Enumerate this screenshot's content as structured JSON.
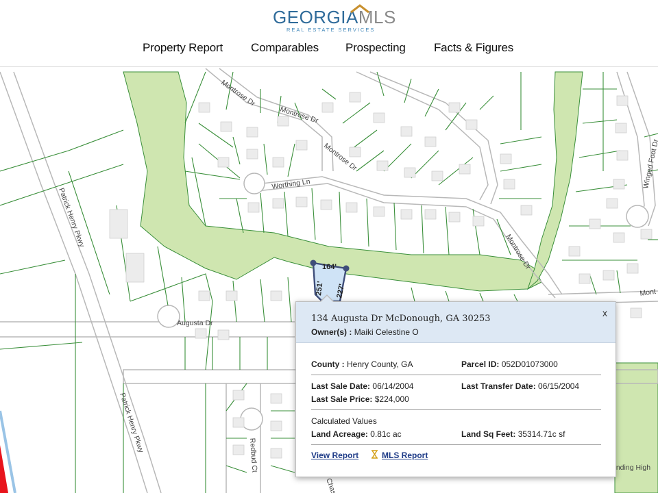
{
  "header": {
    "logo_main": "GEORGIA",
    "logo_mls": "MLS",
    "logo_sub": "REAL ESTATE SERVICES",
    "nav": [
      "Property Report",
      "Comparables",
      "Prospecting",
      "Facts & Figures"
    ]
  },
  "map": {
    "street_labels": {
      "montrose_1": "Montrose Dr",
      "montrose_2": "Montrose Dr",
      "montrose_3": "Montrose Dr",
      "montrose_4": "Montrose Dr",
      "montrose_5": "Mont",
      "worthing": "Worthing Ln",
      "augusta": "Augusta Dr",
      "patrick_1": "Patrick Henry Pkwy",
      "patrick_2": "Patrick Henry Pkwy",
      "winged_foot": "Winged Foot Dr",
      "redbud": "Redbud Ct",
      "chase": "Chas",
      "landing": "anding High"
    },
    "dimensions": {
      "top": "164'",
      "left": "251'",
      "right": "227'"
    },
    "colors": {
      "greenspace": "#cfe6b0",
      "parcel_line": "#3a8f3a",
      "road": "#b8b8b8",
      "selected_parcel": "#cfe3f6",
      "edge_accent": "#e8141c"
    }
  },
  "popup": {
    "address": "134 Augusta Dr McDonough, GA 30253",
    "owner_label": "Owner(s) :",
    "owner_value": "Maiki Celestine O",
    "county_label": "County :",
    "county_value": "Henry County, GA",
    "parcel_label": "Parcel ID:",
    "parcel_value": "052D01073000",
    "last_sale_date_label": "Last Sale Date:",
    "last_sale_date_value": "06/14/2004",
    "last_transfer_label": "Last Transfer Date:",
    "last_transfer_value": "06/15/2004",
    "last_sale_price_label": "Last Sale Price:",
    "last_sale_price_value": "$224,000",
    "calculated": "Calculated Values",
    "acreage_label": "Land Acreage:",
    "acreage_value": "0.81c ac",
    "sqft_label": "Land Sq Feet:",
    "sqft_value": "35314.71c sf",
    "view_report": "View Report",
    "mls_report": "MLS Report",
    "close": "x",
    "hourglass_icon": "hourglass-icon"
  }
}
